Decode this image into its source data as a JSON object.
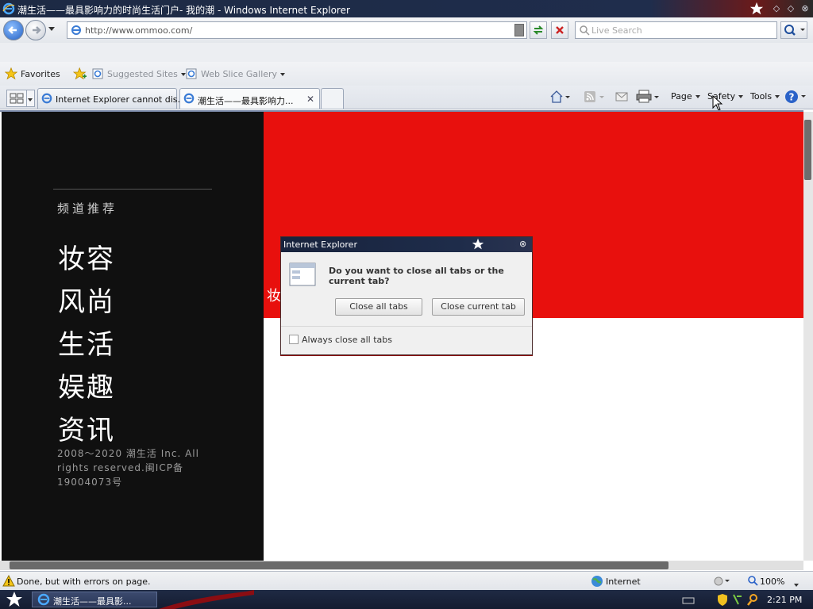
{
  "window": {
    "title": "潮生活——最具影响力的时尚生活门户- 我的潮 - Windows Internet Explorer"
  },
  "address_bar": {
    "url": "http://www.ommoo.com/",
    "search_placeholder": "Live Search"
  },
  "favorites_bar": {
    "favorites_label": "Favorites",
    "items": [
      {
        "label": "Suggested Sites"
      },
      {
        "label": "Web Slice Gallery"
      }
    ]
  },
  "tabs": [
    {
      "label": "Internet Explorer cannot dis...",
      "active": false
    },
    {
      "label": "潮生活——最具影响力...",
      "active": true
    }
  ],
  "command_bar": {
    "page": "Page",
    "safety": "Safety",
    "tools": "Tools"
  },
  "page": {
    "channel_heading": "频道推荐",
    "channels": [
      "妆容",
      "风尚",
      "生活",
      "娱趣",
      "资讯"
    ],
    "copyright": "2008～2020 潮生活 Inc. All rights reserved.闽ICP备19004073号",
    "banner_peek_text": "妆",
    "banner_color": "#e8100d"
  },
  "dialog": {
    "title": "Internet Explorer",
    "question": "Do you want to close all tabs or the current tab?",
    "close_all_label": "Close all tabs",
    "close_current_label": "Close current tab",
    "checkbox_label": "Always close all tabs",
    "checkbox_checked": false
  },
  "status_bar": {
    "text": "Done, but with errors on page.",
    "zone": "Internet",
    "zoom": "100%"
  },
  "taskbar": {
    "task_label": "潮生活——最具影...",
    "clock": "2:21 PM"
  }
}
